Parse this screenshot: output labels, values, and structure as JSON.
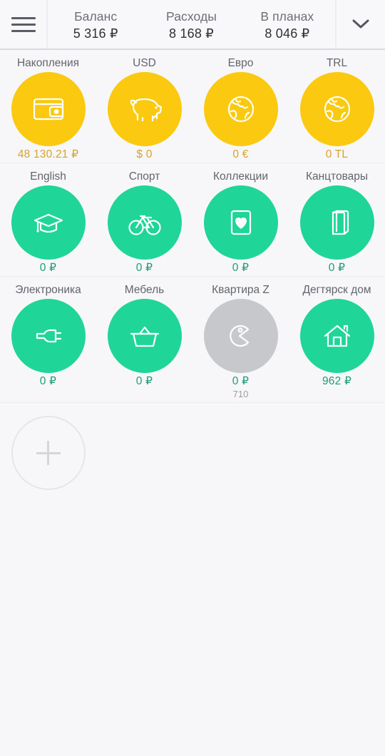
{
  "header": {
    "menu_icon": "hamburger-menu-icon",
    "expand_icon": "chevron-down-icon",
    "stats": [
      {
        "label": "Баланс",
        "value": "5 316 ₽"
      },
      {
        "label": "Расходы",
        "value": "8 168 ₽"
      },
      {
        "label": "В планах",
        "value": "8 046 ₽"
      }
    ]
  },
  "colors": {
    "yellow": "#fbc90f",
    "yellow_text": "#d6a32e",
    "green": "#1fd598",
    "green_text": "#1d9d75",
    "gray": "#c6c8cb",
    "gray_text": "#9c9ea6",
    "background": "#f7f7f9"
  },
  "accounts": [
    {
      "name": "Накопления",
      "amount": "48 130.21 ₽",
      "sub": "",
      "icon": "wallet-icon",
      "color": "yellow"
    },
    {
      "name": "USD",
      "amount": "$ 0",
      "sub": "",
      "icon": "piggy-bank-icon",
      "color": "yellow"
    },
    {
      "name": "Евро",
      "amount": "0 €",
      "sub": "",
      "icon": "globe-icon",
      "color": "yellow"
    },
    {
      "name": "TRL",
      "amount": "0 TL",
      "sub": "",
      "icon": "globe-icon",
      "color": "yellow"
    },
    {
      "name": "English",
      "amount": "0 ₽",
      "sub": "",
      "icon": "graduation-cap-icon",
      "color": "green"
    },
    {
      "name": "Спорт",
      "amount": "0 ₽",
      "sub": "",
      "icon": "bicycle-icon",
      "color": "green"
    },
    {
      "name": "Коллекции",
      "amount": "0 ₽",
      "sub": "",
      "icon": "heart-card-icon",
      "color": "green"
    },
    {
      "name": "Канцтовары",
      "amount": "0 ₽",
      "sub": "",
      "icon": "books-icon",
      "color": "green"
    },
    {
      "name": "Электроника",
      "amount": "0 ₽",
      "sub": "",
      "icon": "power-plug-icon",
      "color": "green"
    },
    {
      "name": "Мебель",
      "amount": "0 ₽",
      "sub": "",
      "icon": "basket-icon",
      "color": "green"
    },
    {
      "name": "Квартира Z",
      "amount": "0 ₽",
      "sub": "710",
      "icon": "pacman-icon",
      "color": "gray"
    },
    {
      "name": "Дегтярск дом",
      "amount": "962 ₽",
      "sub": "",
      "icon": "house-icon",
      "color": "green"
    }
  ],
  "add_button": {
    "icon": "plus-icon",
    "label": ""
  }
}
